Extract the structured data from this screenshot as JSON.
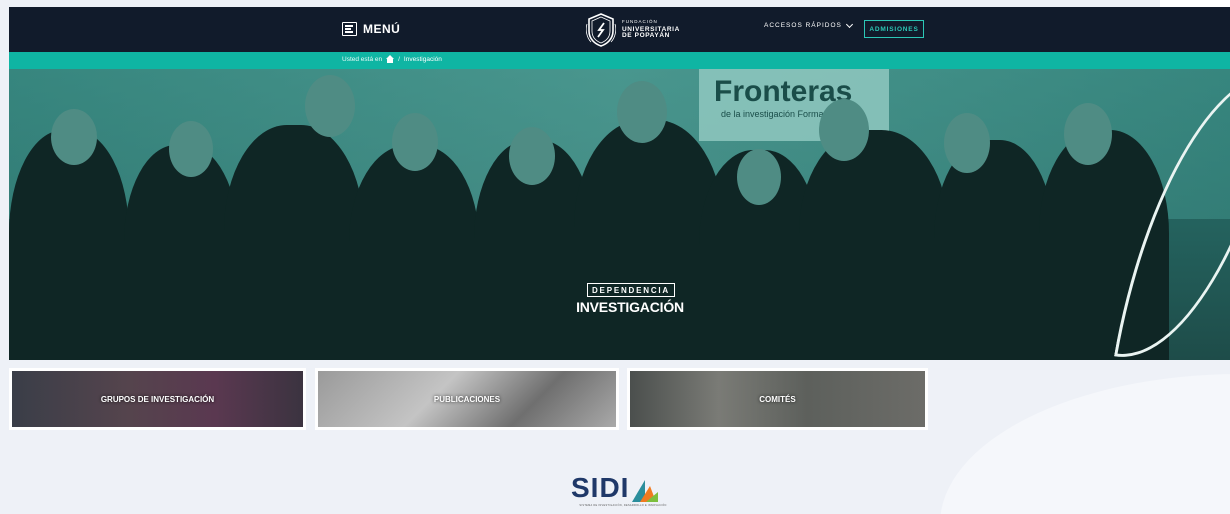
{
  "header": {
    "menu_label": "MENÚ",
    "logo": {
      "line1": "FUNDACIÓN",
      "line2": "UNIVERSITARIA",
      "line3": "DE POPAYÁN"
    },
    "quick_access_label": "ACCESOS RÁPIDOS",
    "admissions_label": "ADMISIONES"
  },
  "breadcrumb": {
    "prefix": "Usted está en",
    "separator": "/",
    "current": "Investigación"
  },
  "hero": {
    "banner_title": "Fronteras",
    "banner_subtitle": "de la investigación Formativa",
    "kicker": "DEPENDENCIA",
    "title": "INVESTIGACIÓN"
  },
  "cards": [
    {
      "label": "GRUPOS DE INVESTIGACIÓN"
    },
    {
      "label": "PUBLICACIONES"
    },
    {
      "label": "COMITÉS"
    }
  ],
  "footer_logo": {
    "text": "SIDI",
    "subtitle": "SISTEMA DE INVESTIGACIÓN, DESARROLLO E INNOVACIÓN"
  },
  "colors": {
    "header_bg": "#111b2b",
    "accent": "#0fb5a3",
    "admissions_border": "#2cc7b6",
    "page_bg": "#eef1f7",
    "sidi_blue": "#1f3868"
  }
}
